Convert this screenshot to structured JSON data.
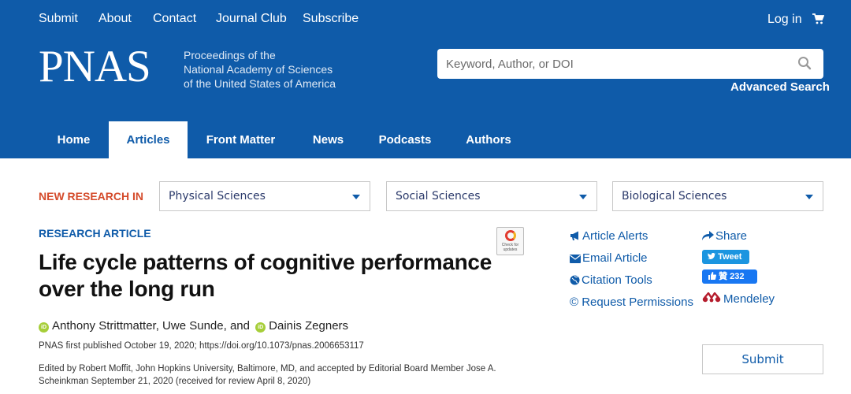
{
  "top_nav": {
    "items": [
      "Submit",
      "About",
      "Contact",
      "Journal Club",
      "Subscribe"
    ],
    "login": "Log in"
  },
  "brand": {
    "logo": "PNAS",
    "tagline": [
      "Proceedings of the",
      "National Academy of Sciences",
      "of the United States of America"
    ]
  },
  "search": {
    "placeholder": "Keyword, Author, or DOI",
    "advanced": "Advanced Search"
  },
  "main_nav": {
    "tabs": [
      "Home",
      "Articles",
      "Front Matter",
      "News",
      "Podcasts",
      "Authors"
    ],
    "active": "Articles"
  },
  "new_research": {
    "label": "NEW RESEARCH IN",
    "dropdowns": [
      "Physical Sciences",
      "Social Sciences",
      "Biological Sciences"
    ]
  },
  "article": {
    "type": "RESEARCH ARTICLE",
    "title": "Life cycle patterns of cognitive performance over the long run",
    "badge": "Check for updates",
    "authors": {
      "a1": "Anthony Strittmatter, Uwe Sunde, and",
      "a2": "Dainis Zegners"
    },
    "published": "PNAS first published October 19, 2020;",
    "doi": "https://doi.org/10.1073/pnas.2006653117",
    "edited_line1": "Edited by Robert Moffit, John Hopkins University, Baltimore, MD, and accepted by Editorial Board Member Jose A.",
    "edited_line2": "Scheinkman September 21, 2020 (received for review April 8, 2020)"
  },
  "tools": {
    "alerts": "Article Alerts",
    "email": "Email Article",
    "citation": "Citation Tools",
    "permissions": "© Request Permissions"
  },
  "share": {
    "label": "Share",
    "tweet": "Tweet",
    "fb_label": "贊",
    "fb_count": "232",
    "mendeley": "Mendeley"
  },
  "submit": "Submit",
  "colors": {
    "brand_blue": "#0f5ba9",
    "new_research_red": "#d44a2a",
    "tweet_blue": "#1b95e0",
    "orcid_green": "#a6ce39"
  }
}
